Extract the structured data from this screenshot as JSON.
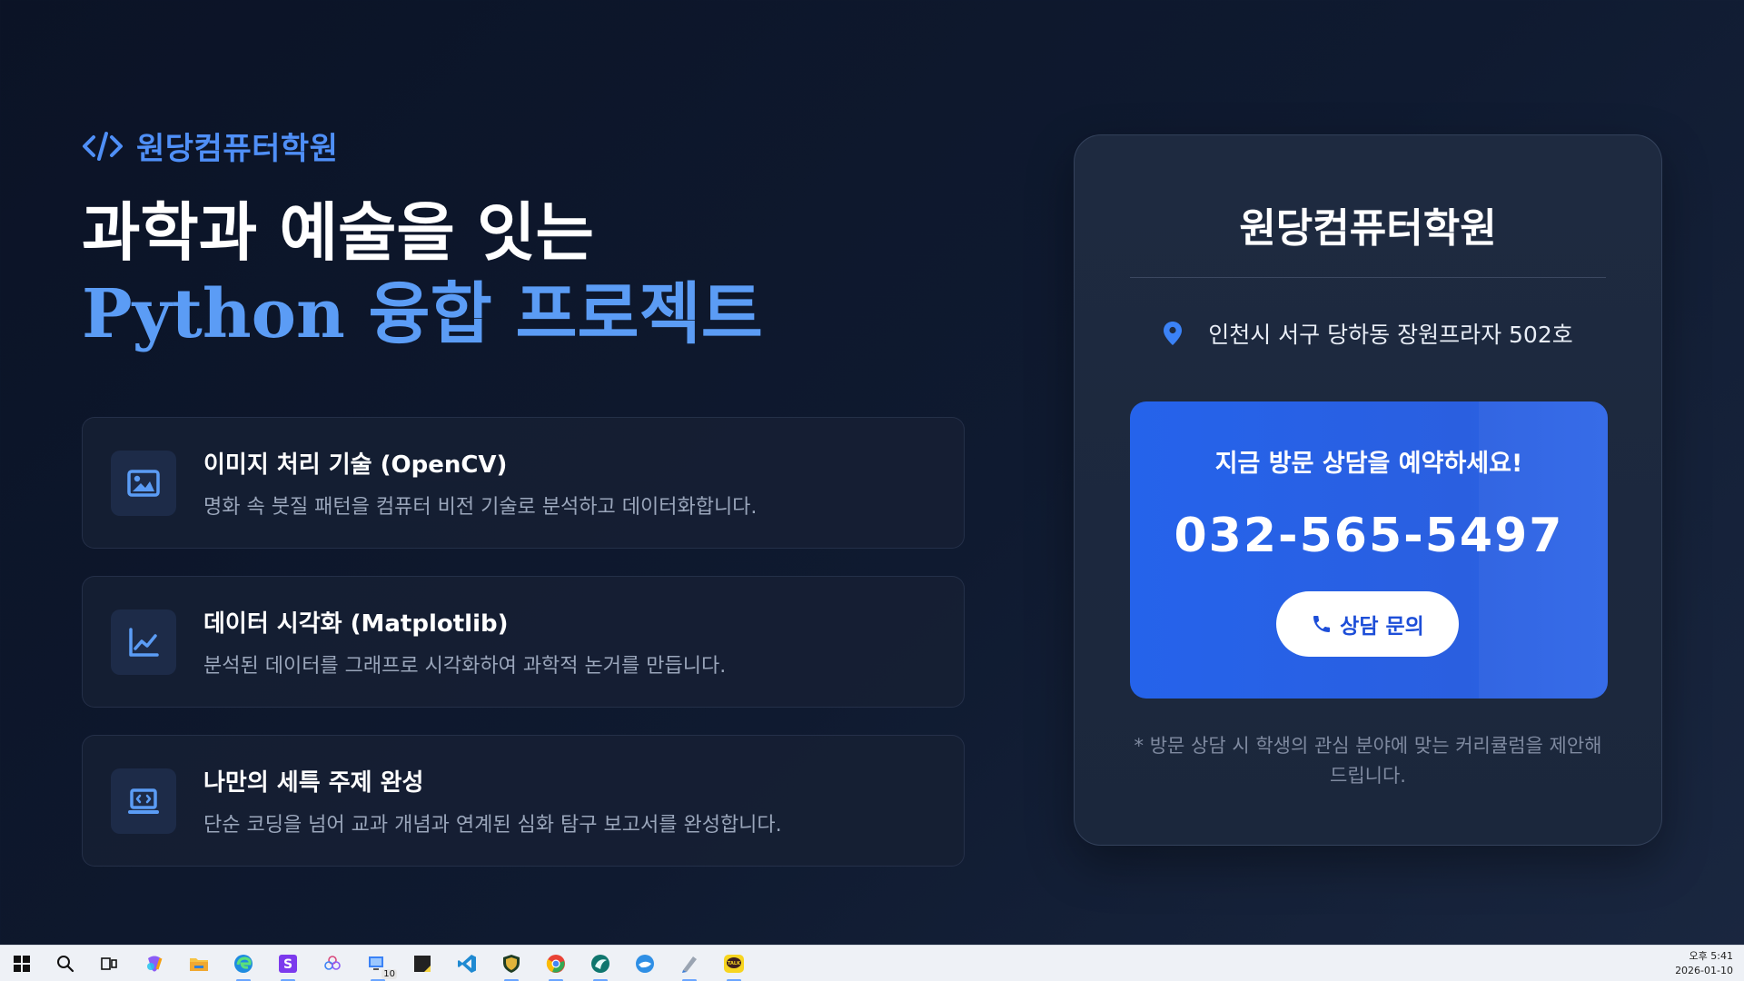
{
  "brand": {
    "name": "원당컴퓨터학원",
    "icon": "code-brackets-icon"
  },
  "headline": {
    "line1": "과학과 예술을 잇는",
    "line2": "Python 융합 프로젝트"
  },
  "features": [
    {
      "icon": "image-icon",
      "title": "이미지 처리 기술 (OpenCV)",
      "desc": "명화 속 붓질 패턴을 컴퓨터 비전 기술로 분석하고 데이터화합니다."
    },
    {
      "icon": "line-chart-icon",
      "title": "데이터 시각화 (Matplotlib)",
      "desc": "분석된 데이터를 그래프로 시각화하여 과학적 논거를 만듭니다."
    },
    {
      "icon": "laptop-code-icon",
      "title": "나만의 세특 주제 완성",
      "desc": "단순 코딩을 넘어 교과 개념과 연계된 심화 탐구 보고서를 완성합니다."
    }
  ],
  "card": {
    "title": "원당컴퓨터학원",
    "address": "인천시 서구 당하동 장원프라자 502호",
    "address_icon": "map-pin-icon",
    "cta": {
      "title": "지금 방문 상담을 예약하세요!",
      "phone": "032-565-5497",
      "button_label": "상담 문의",
      "button_icon": "phone-icon"
    },
    "note": "* 방문 상담 시 학생의 관심 분야에 맞는 커리큘럼을 제안해 드립니다."
  },
  "colors": {
    "accent": "#4f8ff7",
    "headline_accent": "#5b9cf5",
    "cta_bg": "#2563eb",
    "card_bg": "#1e2a40",
    "page_bg": "#0b1326"
  },
  "taskbar": {
    "apps": [
      "windows-start-icon",
      "search-icon",
      "task-view-icon",
      "copilot-icon",
      "file-explorer-icon",
      "edge-icon",
      "app-s-icon",
      "app-flower-icon",
      "remote-desktop-icon",
      "sticky-notes-icon",
      "vscode-icon",
      "shield-app-icon",
      "chrome-icon",
      "app-swirl-icon",
      "app-whale-icon",
      "app-pen-icon",
      "kakaotalk-icon"
    ],
    "badge": "10",
    "time": "오후 5:41",
    "date": "2026-01-10"
  }
}
